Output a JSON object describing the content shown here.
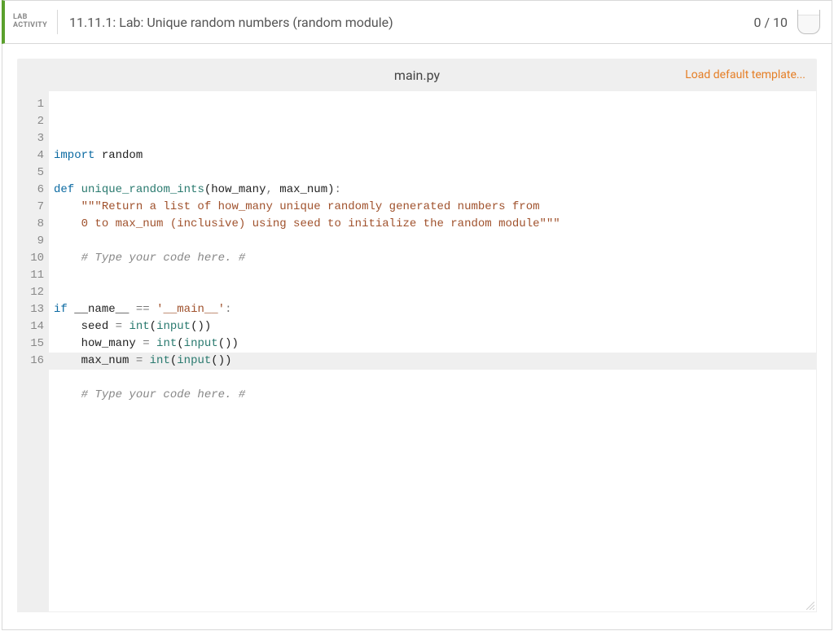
{
  "header": {
    "label_line1": "LAB",
    "label_line2": "ACTIVITY",
    "title": "11.11.1: Lab: Unique random numbers (random module)",
    "score": "0 / 10"
  },
  "editor": {
    "filename": "main.py",
    "load_link": "Load default template...",
    "active_line": 16,
    "lines": [
      {
        "n": 1,
        "tokens": [
          [
            "kw",
            "import"
          ],
          [
            "sp",
            " "
          ],
          [
            "name",
            "random"
          ]
        ]
      },
      {
        "n": 2,
        "tokens": []
      },
      {
        "n": 3,
        "tokens": [
          [
            "kw",
            "def"
          ],
          [
            "sp",
            " "
          ],
          [
            "fn",
            "unique_random_ints"
          ],
          [
            "paren",
            "("
          ],
          [
            "name",
            "how_many"
          ],
          [
            "op",
            ","
          ],
          [
            "sp",
            " "
          ],
          [
            "name",
            "max_num"
          ],
          [
            "paren",
            ")"
          ],
          [
            "op",
            ":"
          ]
        ]
      },
      {
        "n": 4,
        "tokens": [
          [
            "sp",
            "    "
          ],
          [
            "str",
            "\"\"\"Return a list of how_many unique randomly generated numbers from"
          ]
        ]
      },
      {
        "n": 5,
        "tokens": [
          [
            "sp",
            "    "
          ],
          [
            "str",
            "0 to max_num (inclusive) using seed to initialize the random module\"\"\""
          ]
        ]
      },
      {
        "n": 6,
        "tokens": []
      },
      {
        "n": 7,
        "tokens": [
          [
            "sp",
            "    "
          ],
          [
            "com",
            "# Type your code here. #"
          ]
        ]
      },
      {
        "n": 8,
        "tokens": []
      },
      {
        "n": 9,
        "tokens": []
      },
      {
        "n": 10,
        "tokens": [
          [
            "kw",
            "if"
          ],
          [
            "sp",
            " "
          ],
          [
            "name",
            "__name__"
          ],
          [
            "sp",
            " "
          ],
          [
            "op",
            "=="
          ],
          [
            "sp",
            " "
          ],
          [
            "str",
            "'__main__'"
          ],
          [
            "op",
            ":"
          ]
        ]
      },
      {
        "n": 11,
        "tokens": [
          [
            "sp",
            "    "
          ],
          [
            "name",
            "seed"
          ],
          [
            "sp",
            " "
          ],
          [
            "op",
            "="
          ],
          [
            "sp",
            " "
          ],
          [
            "builtin",
            "int"
          ],
          [
            "paren",
            "("
          ],
          [
            "builtin",
            "input"
          ],
          [
            "paren",
            "("
          ],
          [
            "paren",
            ")"
          ],
          [
            "paren",
            ")"
          ]
        ]
      },
      {
        "n": 12,
        "tokens": [
          [
            "sp",
            "    "
          ],
          [
            "name",
            "how_many"
          ],
          [
            "sp",
            " "
          ],
          [
            "op",
            "="
          ],
          [
            "sp",
            " "
          ],
          [
            "builtin",
            "int"
          ],
          [
            "paren",
            "("
          ],
          [
            "builtin",
            "input"
          ],
          [
            "paren",
            "("
          ],
          [
            "paren",
            ")"
          ],
          [
            "paren",
            ")"
          ]
        ]
      },
      {
        "n": 13,
        "tokens": [
          [
            "sp",
            "    "
          ],
          [
            "name",
            "max_num"
          ],
          [
            "sp",
            " "
          ],
          [
            "op",
            "="
          ],
          [
            "sp",
            " "
          ],
          [
            "builtin",
            "int"
          ],
          [
            "paren",
            "("
          ],
          [
            "builtin",
            "input"
          ],
          [
            "paren",
            "("
          ],
          [
            "paren",
            ")"
          ],
          [
            "paren",
            ")"
          ]
        ]
      },
      {
        "n": 14,
        "tokens": []
      },
      {
        "n": 15,
        "tokens": [
          [
            "sp",
            "    "
          ],
          [
            "com",
            "# Type your code here. #"
          ]
        ]
      },
      {
        "n": 16,
        "tokens": []
      }
    ]
  }
}
